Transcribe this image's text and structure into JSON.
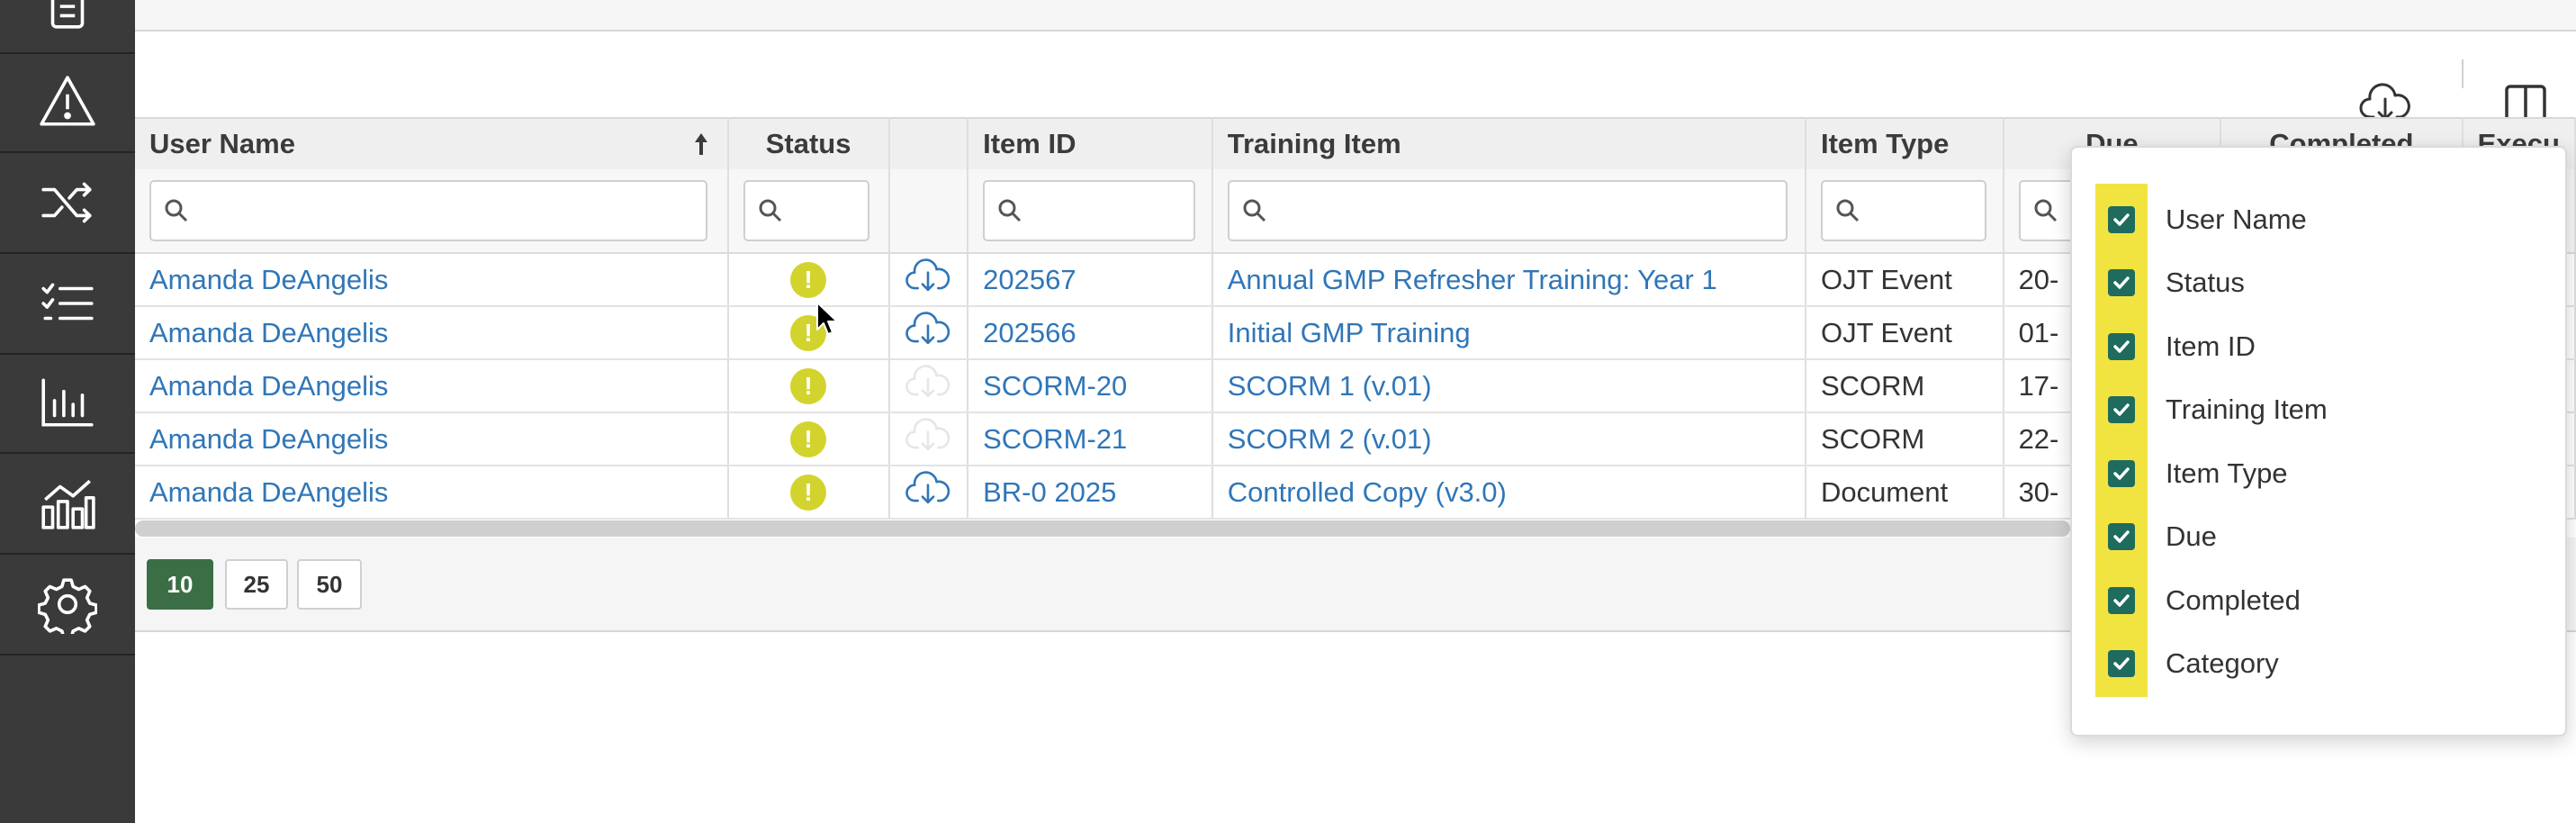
{
  "sidebar": {
    "icons": [
      "checklist-box-icon",
      "warning-icon",
      "shuffle-icon",
      "task-list-icon",
      "bar-chart-icon",
      "analytics-icon",
      "gear-icon"
    ]
  },
  "table": {
    "columns": [
      "User Name",
      "Status",
      "",
      "Item ID",
      "Training Item",
      "Item Type",
      "Due",
      "Completed",
      "Execu"
    ],
    "rows": [
      {
        "user": "Amanda DeAngelis",
        "status": "!",
        "download": true,
        "item_id": "202567",
        "training_item": "Annual GMP Refresher Training: Year 1",
        "item_type": "OJT Event",
        "due": "20-"
      },
      {
        "user": "Amanda DeAngelis",
        "status": "!",
        "download": true,
        "item_id": "202566",
        "training_item": "Initial GMP Training",
        "item_type": "OJT Event",
        "due": "01-"
      },
      {
        "user": "Amanda DeAngelis",
        "status": "!",
        "download": false,
        "item_id": "SCORM-20",
        "training_item": "SCORM 1 (v.01)",
        "item_type": "SCORM",
        "due": "17-"
      },
      {
        "user": "Amanda DeAngelis",
        "status": "!",
        "download": false,
        "item_id": "SCORM-21",
        "training_item": "SCORM 2 (v.01)",
        "item_type": "SCORM",
        "due": "22-"
      },
      {
        "user": "Amanda DeAngelis",
        "status": "!",
        "download": true,
        "item_id": "BR-0 2025",
        "training_item": "Controlled Copy (v3.0)",
        "item_type": "Document",
        "due": "30-"
      }
    ]
  },
  "pager": {
    "sizes": [
      "10",
      "25",
      "50"
    ],
    "active": "10"
  },
  "column_chooser": {
    "options": [
      {
        "label": "User Name",
        "checked": true
      },
      {
        "label": "Status",
        "checked": true
      },
      {
        "label": "Item ID",
        "checked": true
      },
      {
        "label": "Training Item",
        "checked": true
      },
      {
        "label": "Item Type",
        "checked": true
      },
      {
        "label": "Due",
        "checked": true
      },
      {
        "label": "Completed",
        "checked": true
      },
      {
        "label": "Category",
        "checked": true
      }
    ]
  },
  "colors": {
    "sidebar_bg": "#3a3a3a",
    "link": "#2f76b8",
    "status_warning": "#d3d32e",
    "active_page": "#3b6e45",
    "checkbox": "#1f6b5e",
    "highlight": "#f1e441"
  }
}
